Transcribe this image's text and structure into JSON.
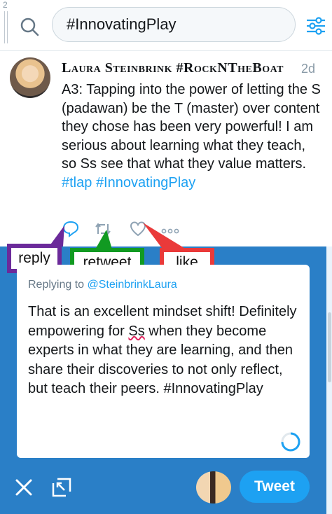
{
  "gutter": {
    "line_number": "2"
  },
  "search": {
    "value": "#InnovatingPlay"
  },
  "tweet": {
    "author": "Laura Steinbrink #RockNTheBoat",
    "time": "2d",
    "text_main": "A3:  Tapping into the power of letting the S (padawan) be the T (master) over content they chose has been very powerful! I am serious about learning what they teach, so Ss see that what they value matters.",
    "hashtag_1": "#tlap",
    "hashtag_2": "#InnovatingPlay"
  },
  "annotations": {
    "reply": "reply",
    "retweet": "retweet",
    "like": "like"
  },
  "reply_box": {
    "replying_to_prefix": "Replying to ",
    "replying_to_handle": "@SteinbrinkLaura",
    "text_1": "That is an excellent mindset shift! Definitely empowering for ",
    "text_ss": "Ss",
    "text_2": " when they become experts in what they are learning, and then share their discoveries to not only reflect, but teach their peers. #InnovatingPlay"
  },
  "compose": {
    "tweet_button": "Tweet"
  },
  "colors": {
    "accent": "#1da1f2",
    "panel": "#2a7fc7",
    "reply_tag": "#6b2a9a",
    "retweet_tag": "#119a22",
    "like_tag": "#ea3a3a"
  }
}
